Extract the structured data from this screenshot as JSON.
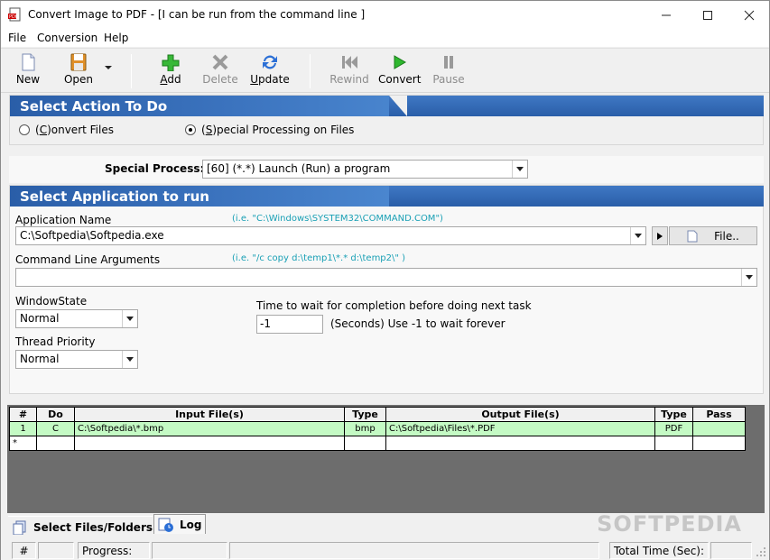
{
  "window": {
    "title": "Convert Image to PDF - [I can be run from the command line ]"
  },
  "menu": [
    "File",
    "Conversion",
    "Help"
  ],
  "toolbar": {
    "new": "New",
    "open": "Open",
    "add": "Add",
    "delete": "Delete",
    "update": "Update",
    "rewind": "Rewind",
    "convert": "Convert",
    "pause": "Pause"
  },
  "action": {
    "header": "Select Action To Do",
    "option1": "(C)onvert Files",
    "option2": "(S)pecial Processing on Files",
    "selected": "option2"
  },
  "special": {
    "label": "Special Process:",
    "value": "[60] (*.*) Launch (Run) a program"
  },
  "app": {
    "header": "Select Application to run",
    "name_label": "Application Name",
    "name_hint": "(i.e. \"C:\\Windows\\SYSTEM32\\COMMAND.COM\")",
    "name_value": "C:\\Softpedia\\Softpedia.exe",
    "file_button": "File..",
    "args_label": "Command Line Arguments",
    "args_hint": "(i.e. \"/c copy   d:\\temp1\\*.*      d:\\temp2\\\" )",
    "args_value": "",
    "window_state_label": "WindowState",
    "window_state_value": "Normal",
    "thread_priority_label": "Thread Priority",
    "thread_priority_value": "Normal",
    "wait_label": "Time to wait for completion before doing next task",
    "wait_value": "-1",
    "wait_hint": "(Seconds) Use -1 to wait forever"
  },
  "grid": {
    "headers": [
      "#",
      "Do",
      "Input File(s)",
      "Type",
      "Output File(s)",
      "Type",
      "Pass"
    ],
    "rows": [
      [
        "1",
        "C",
        "C:\\Softpedia\\*.bmp",
        "bmp",
        "C:\\Softpedia\\Files\\*.PDF",
        "PDF",
        ""
      ],
      [
        "*",
        "",
        "",
        "",
        "",
        "",
        ""
      ]
    ]
  },
  "tabs": {
    "files": "Select Files/Folders",
    "log": "Log"
  },
  "status": {
    "hash": "#",
    "progress": "Progress:",
    "total_time": "Total Time (Sec):"
  },
  "watermark": "SOFTPEDIA",
  "colors": {
    "header_blue": "#2a5ea8",
    "hint": "#1aa0b5",
    "row_green": "#c4fac4"
  }
}
